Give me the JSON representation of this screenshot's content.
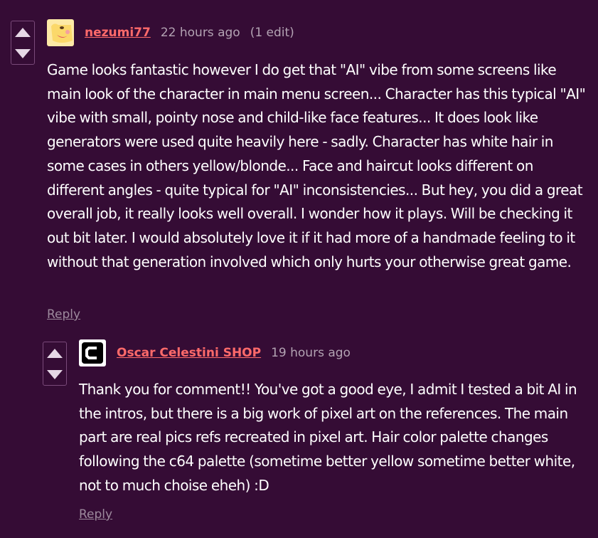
{
  "comments": [
    {
      "username": "nezumi77",
      "timestamp": "22 hours ago",
      "edit_note": "(1 edit)",
      "avatar_icon": "yellow-cartoon-face-avatar",
      "body": "Game looks fantastic however I do get that \"AI\" vibe from some screens like main look of the character in main menu screen... Character has this typical \"AI\" vibe with small, pointy nose and child-like face features... It does look like generators were used quite heavily here - sadly. Character has white hair in some cases in others yellow/blonde... Face and haircut looks different on different angles - quite typical for \"AI\" inconsistencies... But hey, you did a great overall job, it really looks well overall. I wonder how it plays. Will be checking it out bit later. I would absolutely love it if it had more of a handmade feeling to it without that generation involved which only hurts your otherwise great game.",
      "reply_label": "Reply"
    },
    {
      "username": "Oscar Celestini SHOP",
      "timestamp": "19 hours ago",
      "avatar_icon": "c-logo-avatar",
      "body": "Thank you for comment!! You've got a good eye, I admit I tested a bit AI in the intros, but there is a big work of pixel art on the references. The main part are real pics refs recreated in pixel art. Hair color palette changes following the c64 palette (sometime better yellow sometime better white, not to much choise eheh) :D",
      "reply_label": "Reply"
    }
  ],
  "colors": {
    "background": "#350c35",
    "username": "#ff6a6a",
    "meta_text": "#b3a3b3",
    "vote_arrow": "#e6d8e6"
  }
}
